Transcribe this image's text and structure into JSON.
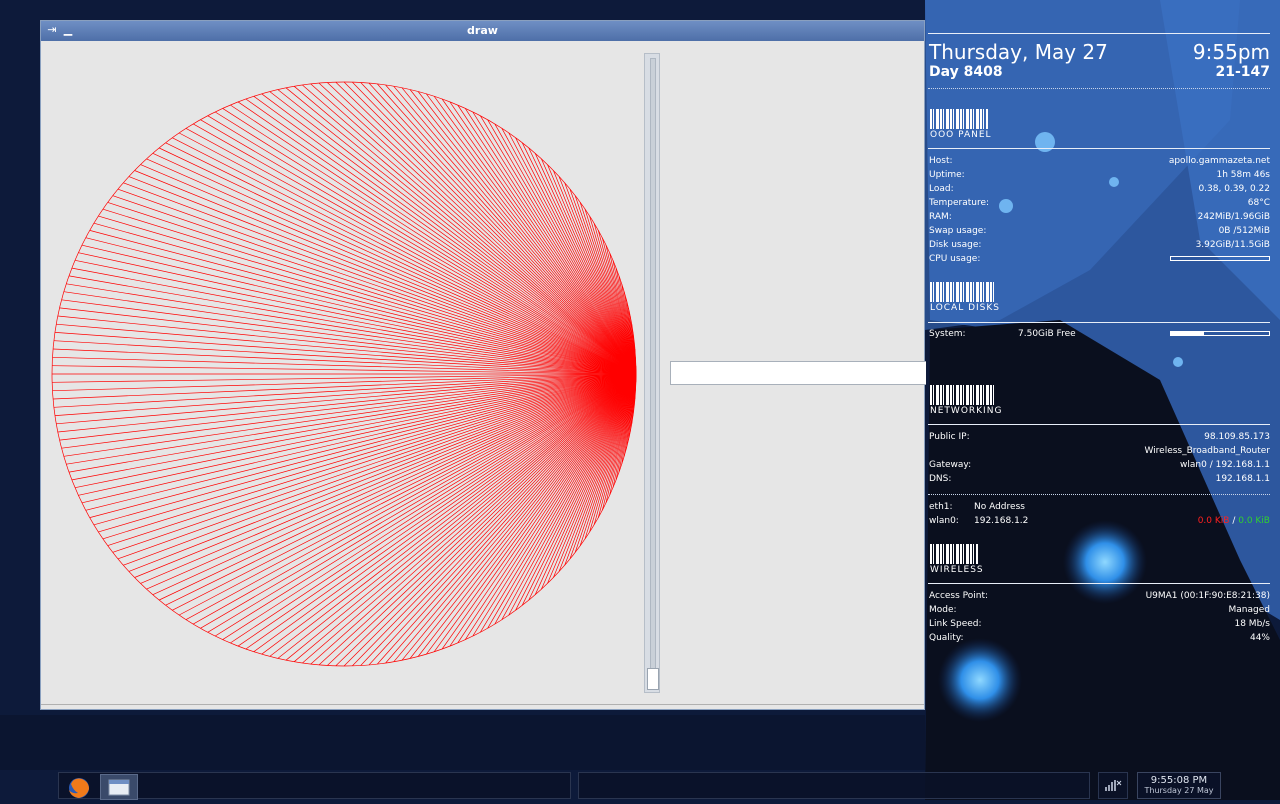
{
  "window": {
    "title": "draw",
    "pin_symbol": "⇥",
    "min_symbol": "▁"
  },
  "conky": {
    "date": "Thursday, May 27",
    "time": "9:55pm",
    "day": "Day 8408",
    "daycode": "21-147",
    "sections": {
      "panel": "OOO PANEL",
      "disks": "LOCAL DISKS",
      "net": "NETWORKING",
      "wireless": "WIRELESS"
    },
    "system": [
      {
        "label": "Host:",
        "value": "apollo.gammazeta.net"
      },
      {
        "label": "Uptime:",
        "value": "1h 58m 46s"
      },
      {
        "label": "Load:",
        "value": "0.38, 0.39, 0.22"
      },
      {
        "label": "Temperature:",
        "value": "68°C"
      },
      {
        "label": "RAM:",
        "value": "242MiB/1.96GiB"
      },
      {
        "label": "Swap usage:",
        "value": "0B  /512MiB"
      },
      {
        "label": "Disk usage:",
        "value": "3.92GiB/11.5GiB"
      },
      {
        "label": "CPU usage:",
        "value": ""
      }
    ],
    "cpu_usage_fraction": 0.0,
    "disk": {
      "label": "System:",
      "free": "7.50GiB Free",
      "used_fraction": 0.34
    },
    "network": [
      {
        "label": "Public IP:",
        "value": "98.109.85.173"
      },
      {
        "label": "",
        "value": "Wireless_Broadband_Router"
      },
      {
        "label": "Gateway:",
        "value": "wlan0 / 192.168.1.1"
      },
      {
        "label": "DNS:",
        "value": "192.168.1.1"
      }
    ],
    "interfaces": [
      {
        "name": "eth1:",
        "addr": "No Address",
        "down": "",
        "sep": "",
        "up": ""
      },
      {
        "name": "wlan0:",
        "addr": "192.168.1.2",
        "down": "0.0 KiB",
        "sep": "/",
        "up": "0.0 KiB"
      }
    ],
    "wifi": [
      {
        "label": "Access Point:",
        "value": "U9MA1  (00:1F:90:E8:21:38)"
      },
      {
        "label": "Mode:",
        "value": "Managed"
      },
      {
        "label": "Link Speed:",
        "value": "18 Mb/s"
      },
      {
        "label": "Quality:",
        "value": "44%"
      }
    ]
  },
  "taskbar": {
    "clock_time": "9:55:08 PM",
    "clock_date": "Thursday 27 May"
  },
  "colors": {
    "line": "#ff0000",
    "down": "#ff2020",
    "up": "#30d030"
  }
}
